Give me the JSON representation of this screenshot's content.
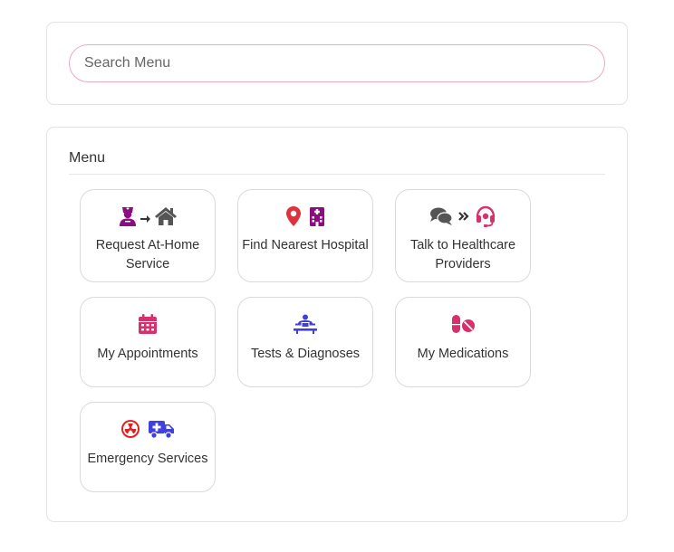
{
  "search": {
    "placeholder": "Search Menu",
    "value": ""
  },
  "menu": {
    "title": "Menu",
    "items": [
      {
        "label": "Request At-Home Service",
        "icons": [
          "nurse-icon",
          "arrow-right-icon",
          "home-icon"
        ]
      },
      {
        "label": "Find Nearest Hospital",
        "icons": [
          "map-pin-icon",
          "hospital-building-icon"
        ]
      },
      {
        "label": "Talk to Healthcare Providers",
        "icons": [
          "chat-bubbles-icon",
          "double-chevron-right-icon",
          "headset-icon"
        ]
      },
      {
        "label": "My Appointments",
        "icons": [
          "calendar-icon"
        ]
      },
      {
        "label": "Tests & Diagnoses",
        "icons": [
          "x-ray-scan-icon"
        ]
      },
      {
        "label": "My Medications",
        "icons": [
          "pills-icon"
        ]
      },
      {
        "label": "Emergency Services",
        "icons": [
          "radiation-icon",
          "ambulance-icon"
        ]
      }
    ]
  },
  "colors": {
    "purple": "#8b0e80",
    "gray": "#555555",
    "red": "#e0323c",
    "pink": "#d6316c",
    "blue": "#4040e0",
    "search_border": "#f0a9c9"
  }
}
